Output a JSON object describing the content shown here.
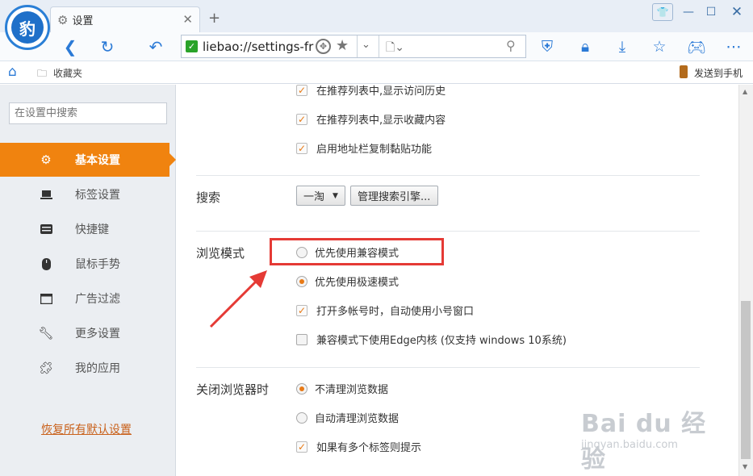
{
  "titlebar": {
    "logo": "liebao-logo",
    "tab_title": "设置",
    "tab_icon": "gear-icon",
    "new_tab_symbol": "+",
    "controls": [
      "skin-icon",
      "minimize-icon",
      "maximize-icon",
      "close-icon"
    ]
  },
  "navbar": {
    "url": "liebao://settings-frame",
    "icons": [
      "back-icon",
      "refresh-icon",
      "undo-icon",
      "shield-icon",
      "lock-icon",
      "download-icon",
      "star-icon",
      "gamepad-icon",
      "more-icon"
    ]
  },
  "bookmarks": {
    "folder_label": "收藏夹",
    "send_to_phone": "发送到手机"
  },
  "sidebar": {
    "search_placeholder": "在设置中搜索",
    "items": [
      {
        "label": "基本设置",
        "icon": "gear-icon",
        "active": true
      },
      {
        "label": "标签设置",
        "icon": "laptop-icon",
        "active": false
      },
      {
        "label": "快捷键",
        "icon": "keyboard-icon",
        "active": false
      },
      {
        "label": "鼠标手势",
        "icon": "mouse-icon",
        "active": false
      },
      {
        "label": "广告过滤",
        "icon": "window-icon",
        "active": false
      },
      {
        "label": "更多设置",
        "icon": "wrench-icon",
        "active": false
      },
      {
        "label": "我的应用",
        "icon": "puzzle-icon",
        "active": false
      }
    ],
    "restore_defaults": "恢复所有默认设置"
  },
  "content": {
    "address_options": [
      {
        "label": "在推荐列表中,显示访问历史",
        "checked": true
      },
      {
        "label": "在推荐列表中,显示收藏内容",
        "checked": true
      },
      {
        "label": "启用地址栏复制黏贴功能",
        "checked": true
      }
    ],
    "search": {
      "title": "搜索",
      "engine_value": "一淘",
      "manage_button": "管理搜索引擎..."
    },
    "browse_mode": {
      "title": "浏览模式",
      "radio_compat": "优先使用兼容模式",
      "radio_speed": "优先使用极速模式",
      "selected": "speed",
      "multi_account": {
        "label": "打开多帐号时，自动使用小号窗口",
        "checked": true
      },
      "edge_kernel": {
        "label": "兼容模式下使用Edge内核 (仅支持 windows 10系统)",
        "checked": false
      }
    },
    "on_close": {
      "title": "关闭浏览器时",
      "radio_keep": "不清理浏览数据",
      "radio_clear": "自动清理浏览数据",
      "selected": "keep",
      "multi_tab_prompt": {
        "label": "如果有多个标签则提示",
        "checked": true
      }
    }
  },
  "colors": {
    "accent": "#f0830f",
    "highlight": "#e53a35",
    "brand_blue": "#2b7ad6"
  },
  "watermark": {
    "big": "Bai du 经验",
    "small": "jingyan.baidu.com"
  }
}
